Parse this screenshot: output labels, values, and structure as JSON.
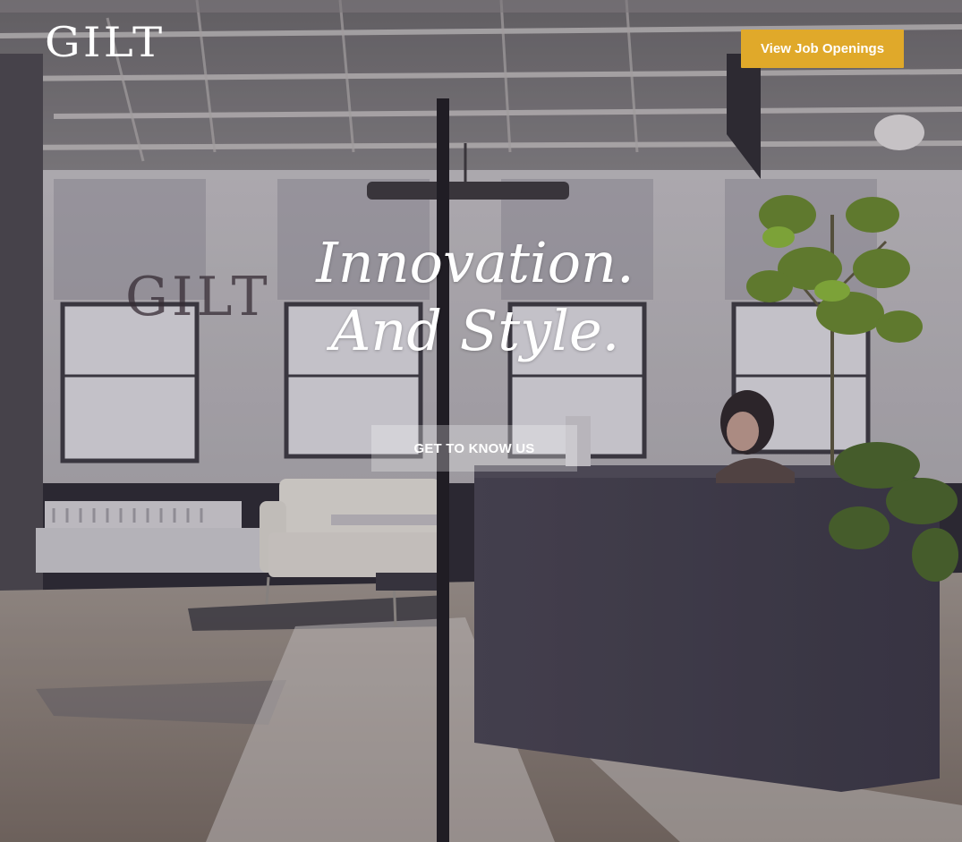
{
  "header": {
    "logo_text": "GILT",
    "jobs_button_label": "View Job Openings"
  },
  "hero": {
    "headline_line1": "Innovation.",
    "headline_line2": "And Style.",
    "cta_label": "GET TO KNOW US",
    "wall_sign_text": "GILT"
  },
  "colors": {
    "accent": "#e0a92a",
    "text": "#ffffff"
  }
}
